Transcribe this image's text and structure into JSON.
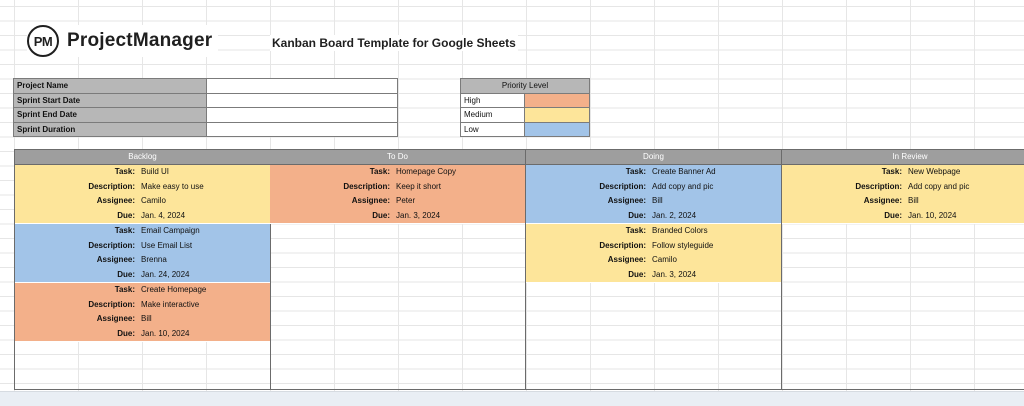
{
  "colors": {
    "high": "#f3b08a",
    "medium": "#fde59a",
    "low": "#a2c4e8",
    "header_gray": "#9e9e9e",
    "label_gray": "#b7b7b7"
  },
  "logo": {
    "mark": "PM",
    "text": "ProjectManager"
  },
  "title": "Kanban Board Template for Google Sheets",
  "info": {
    "project_name": "Project Name",
    "sprint_start": "Sprint Start Date",
    "sprint_end": "Sprint End Date",
    "sprint_duration": "Sprint Duration"
  },
  "priority": {
    "header": "Priority Level",
    "high": "High",
    "medium": "Medium",
    "low": "Low"
  },
  "labels": {
    "task": "Task:",
    "description": "Description:",
    "assignee": "Assignee:",
    "due": "Due:"
  },
  "columns": [
    {
      "title": "Backlog",
      "cards": [
        {
          "priority": "medium",
          "task": "Build UI",
          "description": "Make easy to use",
          "assignee": "Camilo",
          "due": "Jan. 4, 2024"
        },
        {
          "priority": "low",
          "task": "Email Campaign",
          "description": "Use Email List",
          "assignee": "Brenna",
          "due": "Jan. 24, 2024"
        },
        {
          "priority": "high",
          "task": "Create Homepage",
          "description": "Make interactive",
          "assignee": "Bill",
          "due": "Jan. 10, 2024"
        }
      ]
    },
    {
      "title": "To Do",
      "cards": [
        {
          "priority": "high",
          "task": "Homepage Copy",
          "description": "Keep it short",
          "assignee": "Peter",
          "due": "Jan. 3, 2024"
        }
      ]
    },
    {
      "title": "Doing",
      "cards": [
        {
          "priority": "low",
          "task": "Create Banner Ad",
          "description": "Add copy and pic",
          "assignee": "Bill",
          "due": "Jan. 2, 2024"
        },
        {
          "priority": "medium",
          "task": "Branded Colors",
          "description": "Follow styleguide",
          "assignee": "Camilo",
          "due": "Jan. 3, 2024"
        }
      ]
    },
    {
      "title": "In Review",
      "cards": [
        {
          "priority": "medium",
          "task": "New Webpage",
          "description": "Add copy and pic",
          "assignee": "Bill",
          "due": "Jan. 10, 2024"
        }
      ]
    }
  ]
}
